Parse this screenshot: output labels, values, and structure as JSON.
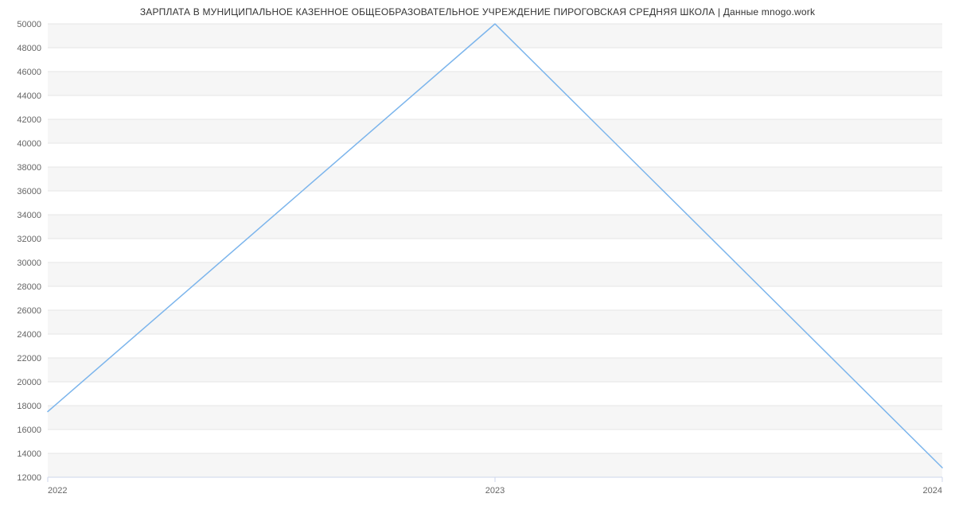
{
  "title": "ЗАРПЛАТА В МУНИЦИПАЛЬНОЕ КАЗЕННОЕ ОБЩЕОБРАЗОВАТЕЛЬНОЕ УЧРЕЖДЕНИЕ ПИРОГОВСКАЯ СРЕДНЯЯ ШКОЛА | Данные mnogo.work",
  "chart_data": {
    "type": "line",
    "x": [
      2022,
      2023,
      2024
    ],
    "values": [
      17500,
      50000,
      12800
    ],
    "title": "ЗАРПЛАТА В МУНИЦИПАЛЬНОЕ КАЗЕННОЕ ОБЩЕОБРАЗОВАТЕЛЬНОЕ УЧРЕЖДЕНИЕ ПИРОГОВСКАЯ СРЕДНЯЯ ШКОЛА | Данные mnogo.work",
    "xlabel": "",
    "ylabel": "",
    "xlim": [
      2022,
      2024
    ],
    "ylim": [
      12000,
      50000
    ],
    "yticks": [
      12000,
      14000,
      16000,
      18000,
      20000,
      22000,
      24000,
      26000,
      28000,
      30000,
      32000,
      34000,
      36000,
      38000,
      40000,
      42000,
      44000,
      46000,
      48000,
      50000
    ],
    "xticks": [
      2022,
      2023,
      2024
    ],
    "grid": true,
    "colors": {
      "series": "#7cb5ec",
      "band": "#f6f6f6",
      "grid": "#e6e6e6",
      "axis": "#ccd6eb",
      "tick_text": "#666666"
    }
  }
}
